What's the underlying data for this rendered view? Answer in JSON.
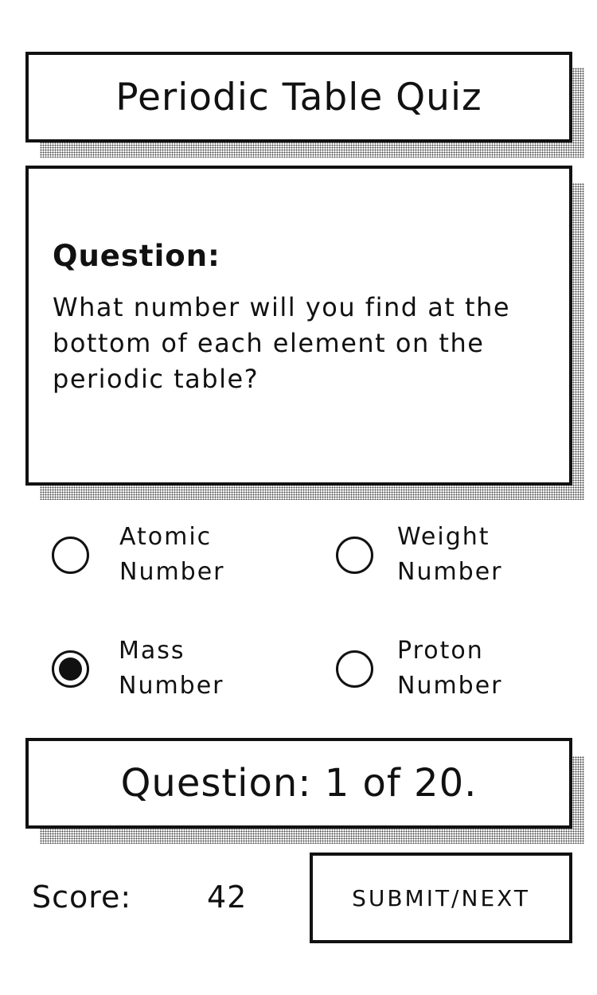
{
  "title": "Periodic Table Quiz",
  "question": {
    "label": "Question:",
    "text": "What number will you find at the bottom of each element on the periodic table?"
  },
  "options": [
    {
      "line1": "Atomic",
      "line2": "Number",
      "selected": false
    },
    {
      "line1": "Weight",
      "line2": "Number",
      "selected": false
    },
    {
      "line1": "Mass",
      "line2": "Number",
      "selected": true
    },
    {
      "line1": "Proton",
      "line2": "Number",
      "selected": false
    }
  ],
  "progress": {
    "text": "Question: 1 of 20."
  },
  "score": {
    "label": "Score:",
    "value": "42"
  },
  "submit_label": "SUBMIT/NEXT",
  "colors": {
    "ink": "#111111",
    "background": "#ffffff"
  }
}
